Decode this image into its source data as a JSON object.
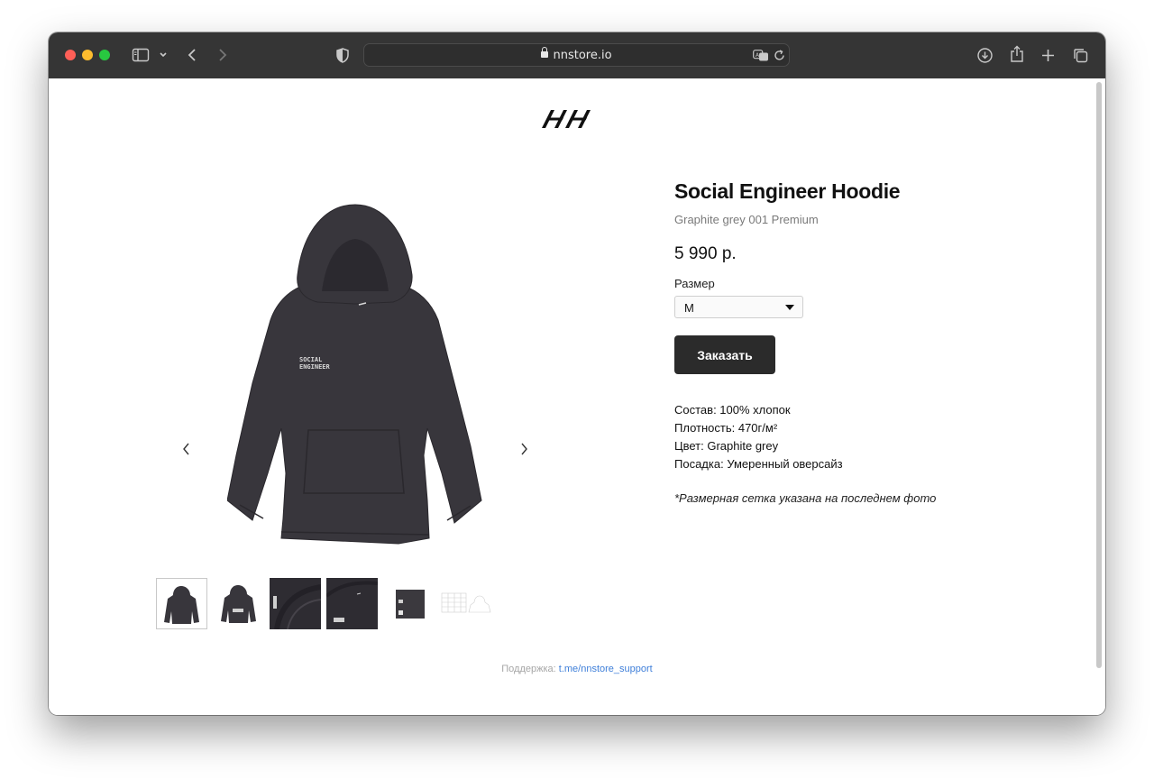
{
  "browser": {
    "url": "nnstore.io"
  },
  "site": {
    "logo_text": "HH"
  },
  "product": {
    "title": "Social Engineer Hoodie",
    "subtitle": "Graphite grey 001 Premium",
    "price": "5 990 р.",
    "size_label": "Размер",
    "size_selected": "M",
    "order_button": "Заказать",
    "specs": [
      "Состав: 100% хлопок",
      "Плотность: 470г/м²",
      "Цвет: Graphite grey",
      "Посадка: Умеренный оверсайз"
    ],
    "note": "*Размерная сетка указана на последнем фото",
    "print_text": [
      "SOCIAL",
      "ENGINEER"
    ]
  },
  "footer": {
    "support_label": "Поддержка:",
    "support_link": "t.me/nnstore_support"
  },
  "colors": {
    "hoodie": "#38363c",
    "button": "#2b2b2b",
    "link": "#3f7fd9",
    "toolbar": "#353535"
  }
}
